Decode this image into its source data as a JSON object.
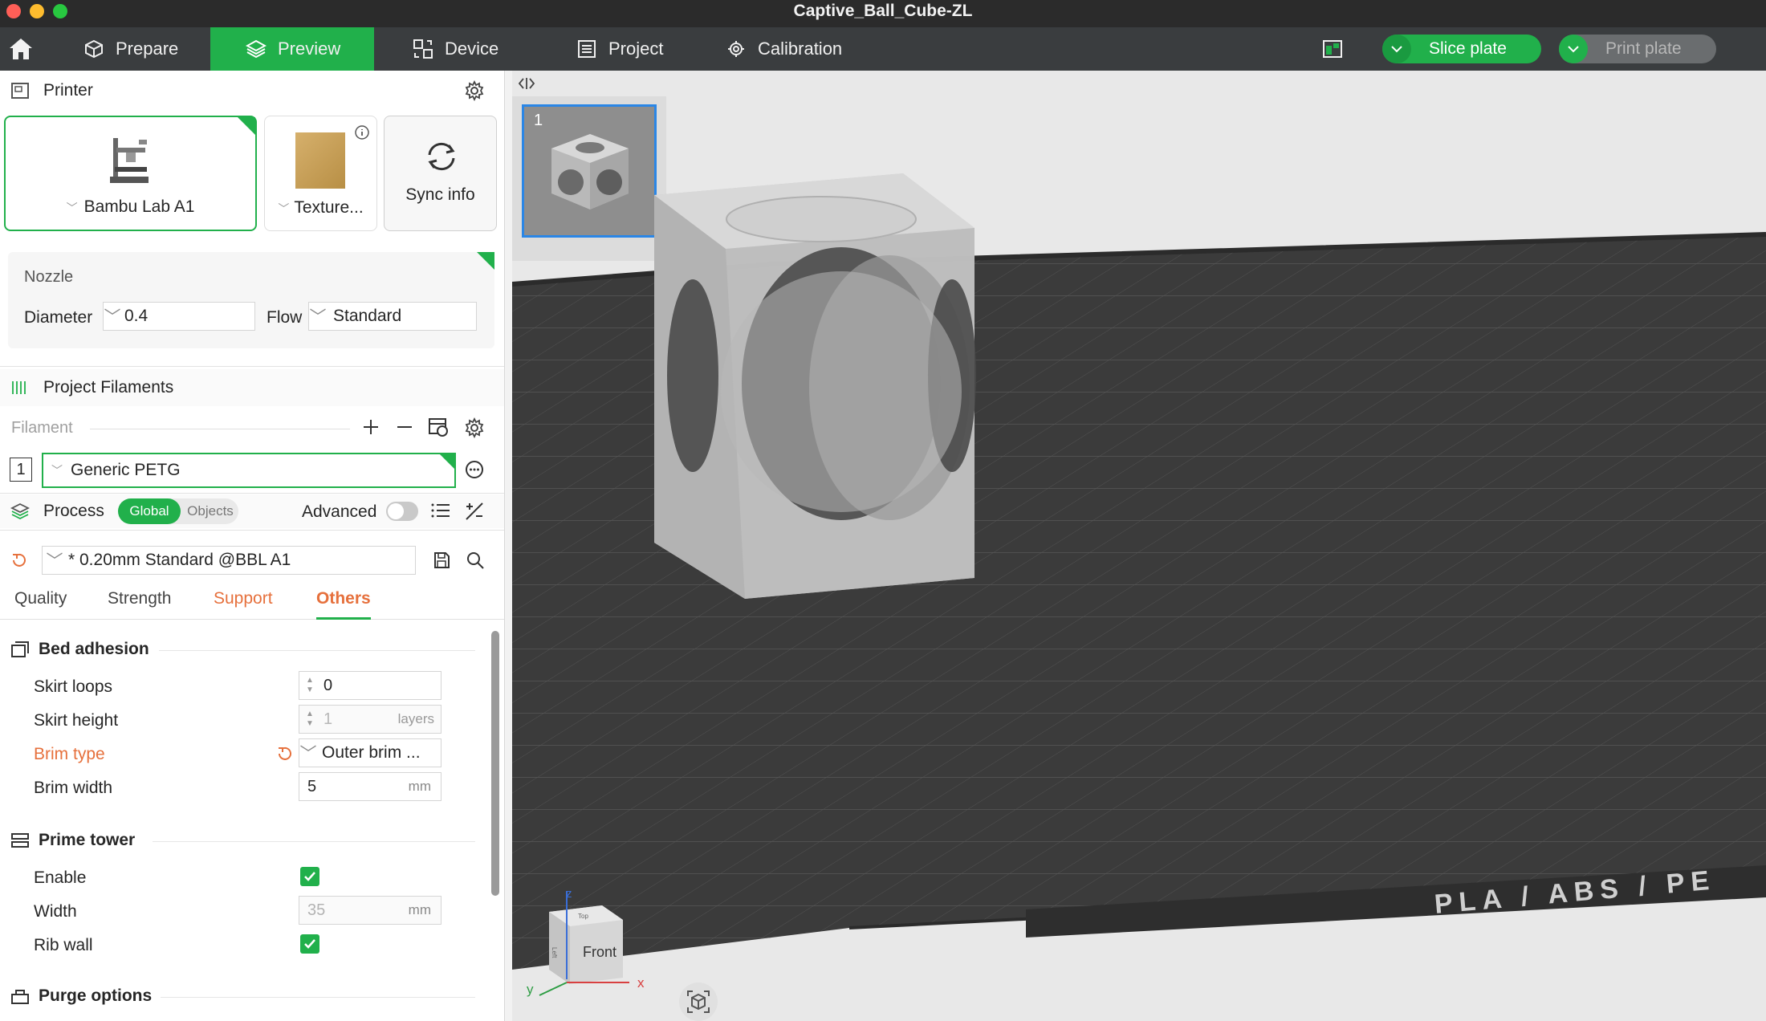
{
  "window": {
    "title": "Captive_Ball_Cube-ZL"
  },
  "toolbar": {
    "tabs": [
      {
        "label": "Prepare",
        "icon": "cube-outline-icon"
      },
      {
        "label": "Preview",
        "icon": "layers-icon",
        "active": true
      },
      {
        "label": "Device",
        "icon": "device-icon"
      },
      {
        "label": "Project",
        "icon": "document-icon"
      },
      {
        "label": "Calibration",
        "icon": "calibration-gear-icon"
      }
    ],
    "slice_label": "Slice plate",
    "print_label": "Print plate"
  },
  "printer": {
    "header": "Printer",
    "printer_name": "Bambu Lab A1",
    "plate_label": "Texture...",
    "sync_label": "Sync info"
  },
  "nozzle": {
    "title": "Nozzle",
    "diameter_label": "Diameter",
    "diameter_value": "0.4",
    "flow_label": "Flow",
    "flow_value": "Standard"
  },
  "filaments": {
    "header": "Project Filaments",
    "filament_label": "Filament",
    "items": [
      {
        "index": "1",
        "name": "Generic PETG"
      }
    ]
  },
  "process": {
    "header": "Process",
    "global_label": "Global",
    "objects_label": "Objects",
    "advanced_label": "Advanced",
    "advanced_on": false,
    "preset": "* 0.20mm Standard @BBL A1",
    "tabs": [
      "Quality",
      "Strength",
      "Support",
      "Others"
    ],
    "selected_tab": "Others"
  },
  "bed_adhesion": {
    "title": "Bed adhesion",
    "skirt_loops_label": "Skirt loops",
    "skirt_loops_value": "0",
    "skirt_height_label": "Skirt height",
    "skirt_height_value": "1",
    "skirt_height_unit": "layers",
    "brim_type_label": "Brim type",
    "brim_type_value": "Outer brim ...",
    "brim_width_label": "Brim width",
    "brim_width_value": "5",
    "brim_width_unit": "mm"
  },
  "prime_tower": {
    "title": "Prime tower",
    "enable_label": "Enable",
    "enable_checked": true,
    "width_label": "Width",
    "width_value": "35",
    "width_unit": "mm",
    "rib_wall_label": "Rib wall",
    "rib_wall_checked": true
  },
  "purge": {
    "title": "Purge options"
  },
  "viewport": {
    "plate_number": "1",
    "bed_text": "PLA / ABS / PE",
    "view_cube_label": "Front",
    "view_cube_top": "Top",
    "view_cube_left": "Left",
    "axis_x": "x",
    "axis_y": "y",
    "axis_z": "z"
  },
  "colors": {
    "accent": "#21b04b",
    "toolbar_bg": "#3a3d3f",
    "titlebar_bg": "#2b2b2b",
    "modified_orange": "#e6703c",
    "bed_dark": "#3b3b3b",
    "viewport_bg": "#e8e8e8"
  }
}
